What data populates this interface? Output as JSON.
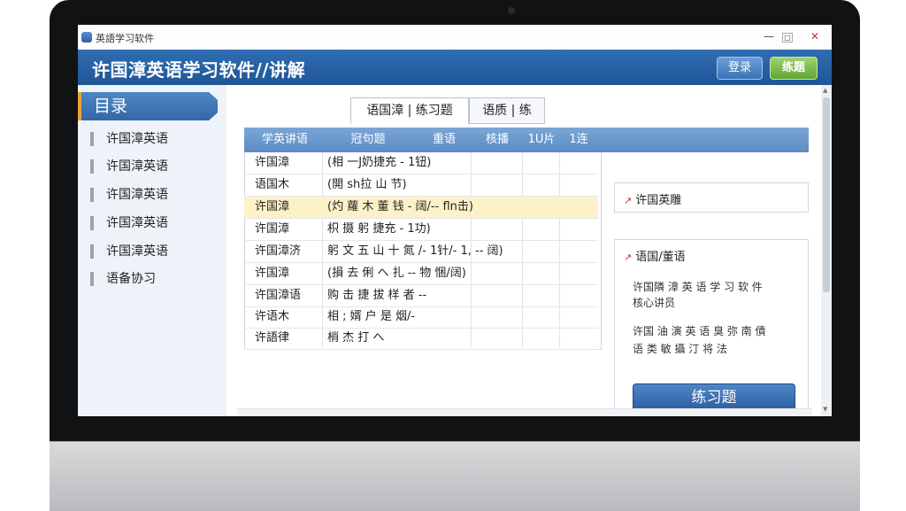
{
  "window": {
    "title": "英語学习软件",
    "minimize": "—",
    "maximize": "□",
    "close": "✕"
  },
  "header": {
    "title": "许国漳英语学习软件//讲解",
    "login_label": "登录",
    "register_label": "练题"
  },
  "sidebar": {
    "heading": "目录",
    "items": [
      {
        "label": "许国漳英语"
      },
      {
        "label": "许国漳英语"
      },
      {
        "label": "许国漳英语"
      },
      {
        "label": "许国漳英语"
      },
      {
        "label": "许国漳英语"
      },
      {
        "label": "语备协习"
      }
    ]
  },
  "tabs": [
    {
      "label": "语国漳 | 练习题"
    },
    {
      "label": "语质 | 练"
    }
  ],
  "table": {
    "headers": [
      "学英讲语",
      "冠句题",
      "重语",
      "核播",
      "1U片",
      "1连"
    ],
    "rows": [
      {
        "c1": "许国漳",
        "c2": "(相 一J奶捷充 - 1钮)",
        "highlight": false
      },
      {
        "c1": "语国木",
        "c2": "(開 sh拉 山 节)",
        "highlight": false
      },
      {
        "c1": "许国漳",
        "c2": "(灼 蘿 木 董 钱 - 阔/-- fln击)",
        "highlight": true
      },
      {
        "c1": "许国漳",
        "c2": "枳 摄 躬 捷充 - 1功)",
        "highlight": false
      },
      {
        "c1": "许国漳济",
        "c2": "躬 文 五 山 十 氮 /- 1针/- 1, -- 阔)",
        "highlight": false
      },
      {
        "c1": "许国漳",
        "c2": "(損 去 俐 へ   扎 -- 物 悃/阔)",
        "highlight": false
      },
      {
        "c1": "许国漳语",
        "c2": "购 击 捷 拔 样 者 --",
        "highlight": false
      },
      {
        "c1": "许语木",
        "c2": "相 ; 婿 户 是 烟/-",
        "highlight": false
      },
      {
        "c1": "许語律",
        "c2": "梢 杰 打 へ",
        "highlight": false
      }
    ]
  },
  "panel_top": {
    "title": "许国英雕"
  },
  "panel_main": {
    "title": "语国/董语",
    "lines": [
      "许国隣 漳 英 语 学 习 软 件",
      "核心讲员",
      "许国 油 演 英 语 臭 弥 南 債",
      "语 类 敏 攝 汀 将 法"
    ],
    "button_label": "练习题"
  },
  "colors": {
    "header_blue": "#2f6db2",
    "accent_green": "#5fa535",
    "highlight_row": "#fdf1c8",
    "grid_header": "#6b98cd"
  }
}
